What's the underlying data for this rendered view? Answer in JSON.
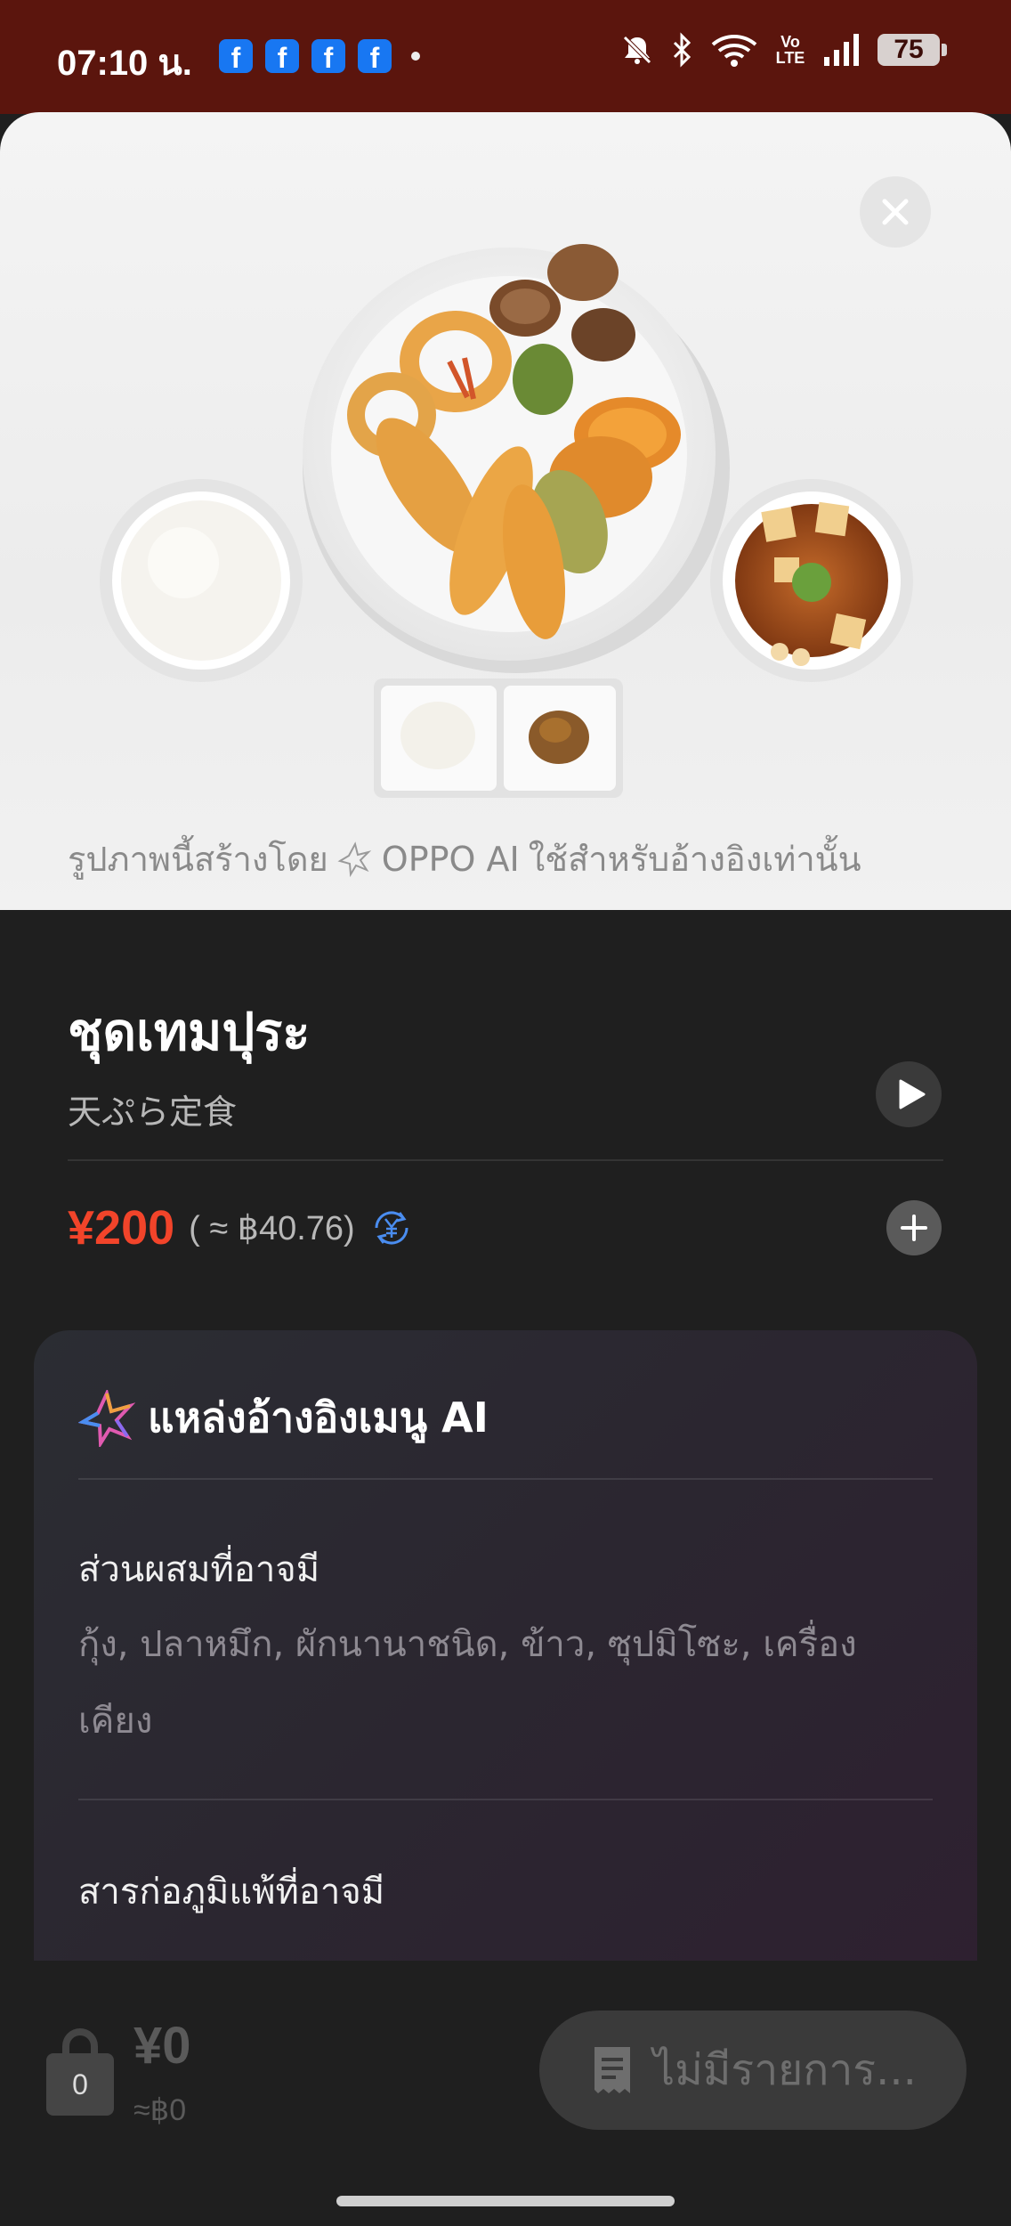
{
  "status_bar": {
    "time": "07:10 น.",
    "notification_icons": [
      "facebook-icon",
      "facebook-icon",
      "facebook-icon",
      "facebook-icon"
    ],
    "fb_glyph": "f",
    "volte": "Vo LTE",
    "battery": "75"
  },
  "hero": {
    "caption_prefix": "รูปภาพนี้สร้างโดย",
    "caption_brand": "OPPO AI",
    "caption_suffix": "ใช้สำหรับอ้างอิงเท่านั้น"
  },
  "dish": {
    "title": "ชุดเทมปุระ",
    "subtitle": "天ぷら定食",
    "price": "¥200",
    "price_converted": "( ≈ ฿40.76)"
  },
  "ai_card": {
    "title": "แหล่งอ้างอิงเมนู AI",
    "ingredients_label": "ส่วนผสมที่อาจมี",
    "ingredients_text": "กุ้ง, ปลาหมึก, ผักนานาชนิด, ข้าว, ซุปมิโซะ, เครื่องเคียง",
    "allergens_label": "สารก่อภูมิแพ้ที่อาจมี"
  },
  "bottom_bar": {
    "cart_count": "0",
    "total": "¥0",
    "total_converted": "≈฿0",
    "order_button": "ไม่มีรายการ..."
  },
  "colors": {
    "status_bar_bg": "#5b150d",
    "price_accent": "#f2442a",
    "page_bg": "#1f1f1f"
  }
}
